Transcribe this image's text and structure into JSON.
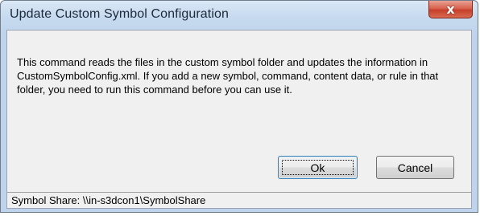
{
  "window": {
    "title": "Update Custom Symbol Configuration",
    "close_icon": "close-icon",
    "close_symbol": "x"
  },
  "message": {
    "text": "This command reads the files in the custom symbol folder and updates the information in CustomSymbolConfig.xml. If you add a new symbol, command, content data, or rule in that folder, you need to run this command before you can use it."
  },
  "buttons": {
    "ok_label": "Ok",
    "cancel_label": "Cancel"
  },
  "status": {
    "text": "Symbol Share: \\\\in-s3dcon1\\SymbolShare"
  },
  "colors": {
    "close_button": "#c7402b",
    "titlebar": "#c7daef",
    "client_background": "#f0f0f0"
  }
}
